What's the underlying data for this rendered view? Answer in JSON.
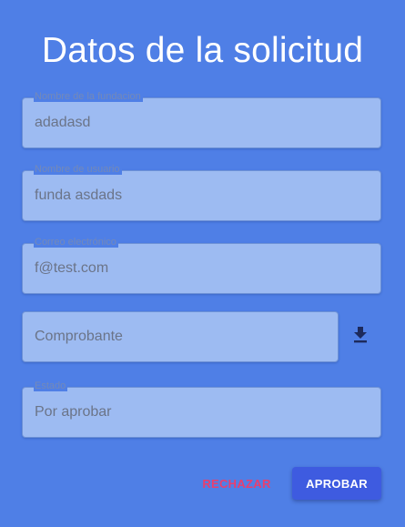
{
  "page": {
    "title": "Datos de la solicitud"
  },
  "form": {
    "foundation_name": {
      "label": "Nombre de la fundacion",
      "value": "adadasd"
    },
    "username": {
      "label": "Nombre de usuario",
      "value": "funda asdads"
    },
    "email": {
      "label": "Correo electrónico",
      "value": "f@test.com"
    },
    "receipt": {
      "placeholder": "Comprobante",
      "icon": "download-icon"
    },
    "status": {
      "label": "Estado",
      "value": "Por aprobar"
    }
  },
  "actions": {
    "reject_label": "RECHAZAR",
    "approve_label": "APROBAR"
  },
  "colors": {
    "background": "#4f7fe6",
    "field_background": "#9dbbf2",
    "reject_text": "#e83f6f",
    "approve_button": "#3e5be0"
  }
}
